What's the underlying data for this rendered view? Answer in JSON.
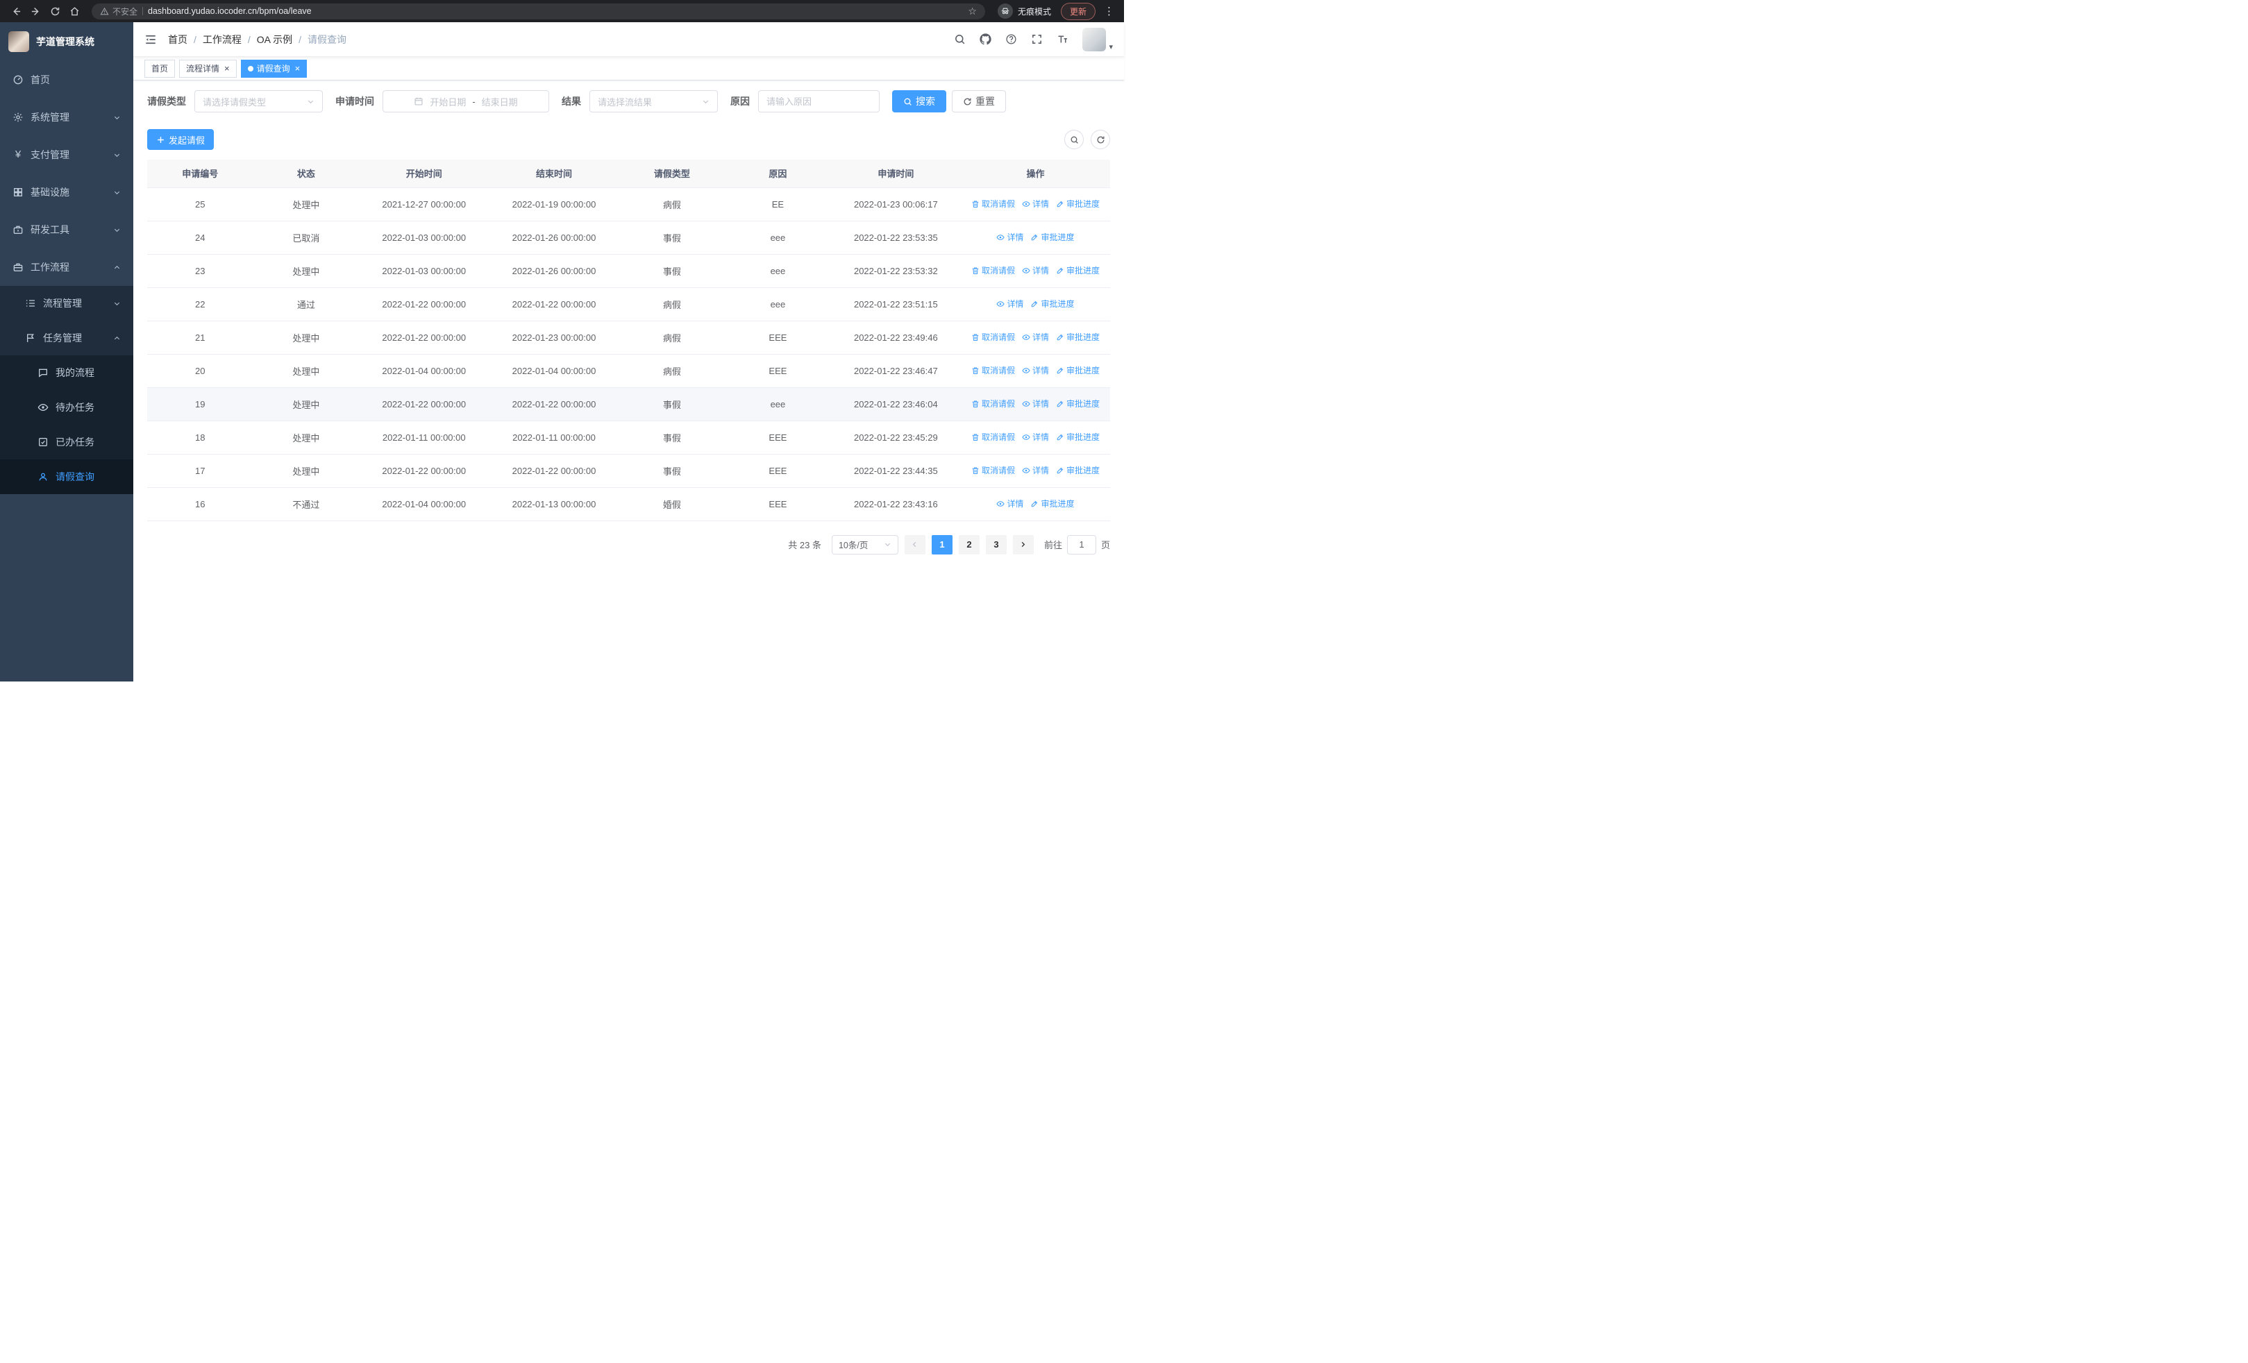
{
  "browser": {
    "security_label": "不安全",
    "url": "dashboard.yudao.iocoder.cn/bpm/oa/leave",
    "incognito_label": "无痕模式",
    "update_label": "更新"
  },
  "icons": {
    "star": "☆",
    "menu_dots": "⋮",
    "close": "×",
    "yen": "¥",
    "breadcrumb_sep": "/",
    "caret": "▾"
  },
  "sidebar": {
    "logo_title": "芋道管理系统",
    "menu": [
      {
        "label": "首页"
      },
      {
        "label": "系统管理"
      },
      {
        "label": "支付管理"
      },
      {
        "label": "基础设施"
      },
      {
        "label": "研发工具"
      },
      {
        "label": "工作流程"
      }
    ],
    "submenu": [
      {
        "label": "流程管理"
      },
      {
        "label": "任务管理"
      }
    ],
    "task_menu": [
      {
        "label": "我的流程"
      },
      {
        "label": "待办任务"
      },
      {
        "label": "已办任务"
      },
      {
        "label": "请假查询"
      }
    ]
  },
  "header": {
    "breadcrumb": [
      "首页",
      "工作流程",
      "OA 示例",
      "请假查询"
    ]
  },
  "tabs": [
    {
      "label": "首页"
    },
    {
      "label": "流程详情"
    },
    {
      "label": "请假查询"
    }
  ],
  "filters": {
    "leave_type_label": "请假类型",
    "leave_type_placeholder": "请选择请假类型",
    "apply_time_label": "申请时间",
    "start_date_placeholder": "开始日期",
    "date_separator": "-",
    "end_date_placeholder": "结束日期",
    "result_label": "结果",
    "result_placeholder": "请选择流结果",
    "reason_label": "原因",
    "reason_placeholder": "请输入原因",
    "search_label": "搜索",
    "reset_label": "重置"
  },
  "toolbar": {
    "create_label": "发起请假"
  },
  "table": {
    "columns": [
      "申请编号",
      "状态",
      "开始时间",
      "结束时间",
      "请假类型",
      "原因",
      "申请时间",
      "操作"
    ],
    "action_labels": {
      "cancel": "取消请假",
      "detail": "详情",
      "progress": "审批进度"
    },
    "rows": [
      {
        "id": "25",
        "status": "处理中",
        "start": "2021-12-27 00:00:00",
        "end": "2022-01-19 00:00:00",
        "type": "病假",
        "reason": "EE",
        "apply": "2022-01-23 00:06:17",
        "actions": [
          "cancel",
          "detail",
          "progress"
        ],
        "hovered": false
      },
      {
        "id": "24",
        "status": "已取消",
        "start": "2022-01-03 00:00:00",
        "end": "2022-01-26 00:00:00",
        "type": "事假",
        "reason": "eee",
        "apply": "2022-01-22 23:53:35",
        "actions": [
          "detail",
          "progress"
        ],
        "hovered": false
      },
      {
        "id": "23",
        "status": "处理中",
        "start": "2022-01-03 00:00:00",
        "end": "2022-01-26 00:00:00",
        "type": "事假",
        "reason": "eee",
        "apply": "2022-01-22 23:53:32",
        "actions": [
          "cancel",
          "detail",
          "progress"
        ],
        "hovered": false
      },
      {
        "id": "22",
        "status": "通过",
        "start": "2022-01-22 00:00:00",
        "end": "2022-01-22 00:00:00",
        "type": "病假",
        "reason": "eee",
        "apply": "2022-01-22 23:51:15",
        "actions": [
          "detail",
          "progress"
        ],
        "hovered": false
      },
      {
        "id": "21",
        "status": "处理中",
        "start": "2022-01-22 00:00:00",
        "end": "2022-01-23 00:00:00",
        "type": "病假",
        "reason": "EEE",
        "apply": "2022-01-22 23:49:46",
        "actions": [
          "cancel",
          "detail",
          "progress"
        ],
        "hovered": false
      },
      {
        "id": "20",
        "status": "处理中",
        "start": "2022-01-04 00:00:00",
        "end": "2022-01-04 00:00:00",
        "type": "病假",
        "reason": "EEE",
        "apply": "2022-01-22 23:46:47",
        "actions": [
          "cancel",
          "detail",
          "progress"
        ],
        "hovered": false
      },
      {
        "id": "19",
        "status": "处理中",
        "start": "2022-01-22 00:00:00",
        "end": "2022-01-22 00:00:00",
        "type": "事假",
        "reason": "eee",
        "apply": "2022-01-22 23:46:04",
        "actions": [
          "cancel",
          "detail",
          "progress"
        ],
        "hovered": true
      },
      {
        "id": "18",
        "status": "处理中",
        "start": "2022-01-11 00:00:00",
        "end": "2022-01-11 00:00:00",
        "type": "事假",
        "reason": "EEE",
        "apply": "2022-01-22 23:45:29",
        "actions": [
          "cancel",
          "detail",
          "progress"
        ],
        "hovered": false
      },
      {
        "id": "17",
        "status": "处理中",
        "start": "2022-01-22 00:00:00",
        "end": "2022-01-22 00:00:00",
        "type": "事假",
        "reason": "EEE",
        "apply": "2022-01-22 23:44:35",
        "actions": [
          "cancel",
          "detail",
          "progress"
        ],
        "hovered": false
      },
      {
        "id": "16",
        "status": "不通过",
        "start": "2022-01-04 00:00:00",
        "end": "2022-01-13 00:00:00",
        "type": "婚假",
        "reason": "EEE",
        "apply": "2022-01-22 23:43:16",
        "actions": [
          "detail",
          "progress"
        ],
        "hovered": false
      }
    ]
  },
  "pagination": {
    "total": "共 23 条",
    "page_size": "10条/页",
    "pages": [
      "1",
      "2",
      "3"
    ],
    "active_page": "1",
    "goto_label": "前往",
    "goto_value": "1",
    "page_suffix": "页"
  },
  "colors": {
    "accent": "#409eff",
    "sidebar_bg": "#304156",
    "submenu_bg": "#1f2d3d"
  }
}
